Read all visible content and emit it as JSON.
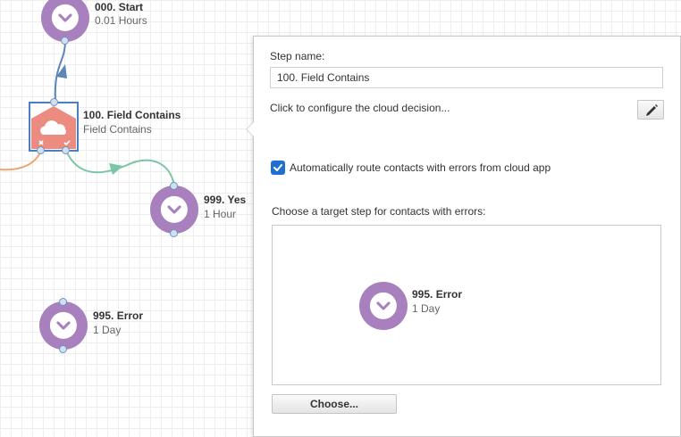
{
  "canvas": {
    "nodes": [
      {
        "title": "000. Start",
        "subtitle": "0.01 Hours",
        "icon": "clock-icon"
      },
      {
        "title": "100. Field Contains",
        "subtitle": "Field Contains",
        "icon": "cloud-icon"
      },
      {
        "title": "999. Yes",
        "subtitle": "1 Hour",
        "icon": "clock-icon"
      },
      {
        "title": "995. Error",
        "subtitle": "1 Day",
        "icon": "clock-icon"
      }
    ]
  },
  "panel": {
    "step_name_label": "Step name:",
    "step_name_value": "100. Field Contains",
    "configure_text": "Click to configure the cloud decision...",
    "auto_route_label": "Automatically route contacts with errors from cloud app",
    "auto_route_checked": true,
    "target_label": "Choose a target step for contacts with errors:",
    "target_step": {
      "title": "995. Error",
      "subtitle": "1 Day"
    },
    "choose_button": "Choose..."
  },
  "colors": {
    "wait_step": "#a780bd",
    "decision_step": "#ec8c80",
    "decision_border": "#4a7fc1",
    "checkbox": "#1f6fd1",
    "connector_blue": "#5b86b5",
    "connector_green": "#7cc5a5",
    "connector_orange": "#f0a470"
  }
}
